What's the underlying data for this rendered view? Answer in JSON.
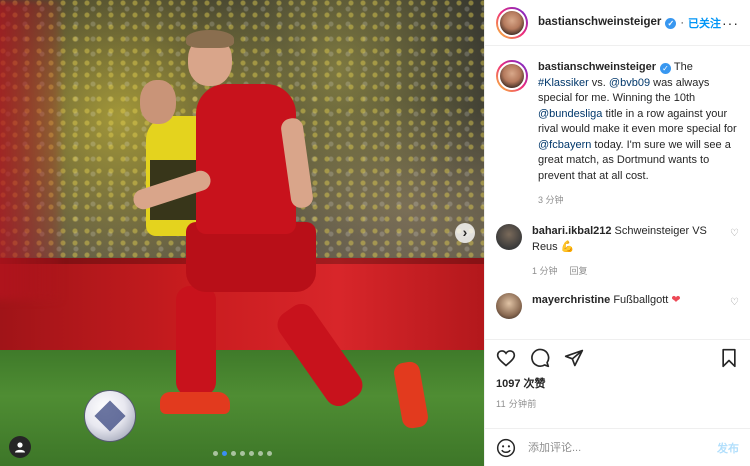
{
  "post": {
    "username": "bastianschweinsteiger",
    "follow_label": "已关注",
    "more_label": "···"
  },
  "caption": {
    "username": "bastianschweinsteiger",
    "text_1": " The ",
    "tag_klassiker": "#Klassiker",
    "text_2": " vs. ",
    "mention_bvb": "@bvb09",
    "text_3": " was always special for me. Winning the 10th ",
    "mention_bundesliga": "@bundesliga",
    "text_4": " title in a row against your rival would make it even more special for ",
    "mention_fcbayern": "@fcbayern",
    "text_5": " today. I'm sure we will see a great match, as Dortmund wants to prevent that at all cost.",
    "time": "3 分钟"
  },
  "comments": [
    {
      "username": "bahari.ikbal212",
      "text": " Schweinsteiger VS Reus ",
      "emoji": "💪",
      "time": "1 分钟",
      "reply_label": "回复"
    },
    {
      "username": "mayerchristine",
      "text": " Fußballgott ",
      "emoji": "❤"
    }
  ],
  "stats": {
    "likes": "1097 次赞",
    "posted_ago": "11 分钟前"
  },
  "composer": {
    "placeholder": "添加评论...",
    "post_label": "发布"
  },
  "media": {
    "next_label": "›",
    "carousel_count": 7,
    "carousel_active": 1
  }
}
